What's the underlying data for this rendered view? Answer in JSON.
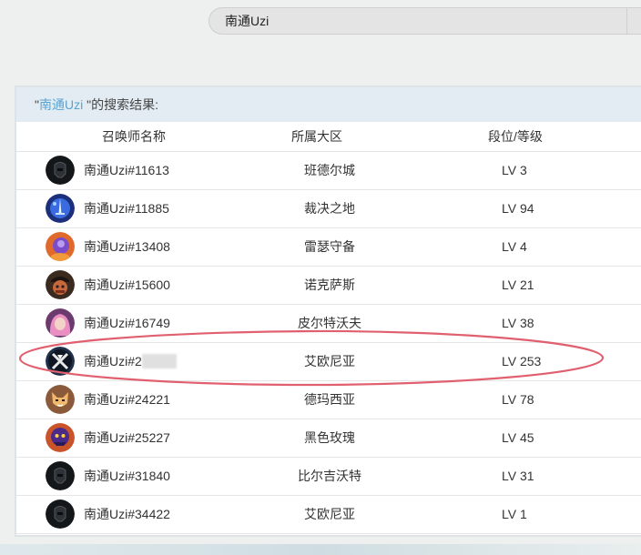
{
  "search": {
    "value": "南通Uzi"
  },
  "results": {
    "heading_prefix": "\"",
    "keyword": "南通Uzi ",
    "heading_suffix": "\"的搜索结果:",
    "columns": {
      "name": "召唤师名称",
      "region": "所属大区",
      "level": "段位/等级"
    },
    "rows": [
      {
        "name": "南通Uzi#11613",
        "region": "班德尔城",
        "level": "LV 3",
        "avatar": "dark-helmet-icon"
      },
      {
        "name": "南通Uzi#11885",
        "region": "裁决之地",
        "level": "LV 94",
        "avatar": "blue-sword-icon"
      },
      {
        "name": "南通Uzi#13408",
        "region": "雷瑟守备",
        "level": "LV 4",
        "avatar": "purple-mage-icon"
      },
      {
        "name": "南通Uzi#15600",
        "region": "诺克萨斯",
        "level": "LV 21",
        "avatar": "pirate-icon"
      },
      {
        "name": "南通Uzi#16749",
        "region": "皮尔特沃夫",
        "level": "LV 38",
        "avatar": "pink-hair-icon"
      },
      {
        "name": "南通Uzi#2",
        "name_masked": true,
        "region": "艾欧尼亚",
        "level": "LV 253",
        "avatar": "crossed-blades-icon",
        "highlighted": true
      },
      {
        "name": "南通Uzi#24221",
        "region": "德玛西亚",
        "level": "LV 78",
        "avatar": "fox-icon"
      },
      {
        "name": "南通Uzi#25227",
        "region": "黑色玫瑰",
        "level": "LV 45",
        "avatar": "purple-beast-icon"
      },
      {
        "name": "南通Uzi#31840",
        "region": "比尔吉沃特",
        "level": "LV 31",
        "avatar": "dark-helmet-icon"
      },
      {
        "name": "南通Uzi#34422",
        "region": "艾欧尼亚",
        "level": "LV 1",
        "avatar": "dark-helmet-icon"
      }
    ]
  },
  "colors": {
    "accent": "#5aa3d0",
    "annotation": "#e0606f",
    "header_bg": "#e3ecf3"
  }
}
